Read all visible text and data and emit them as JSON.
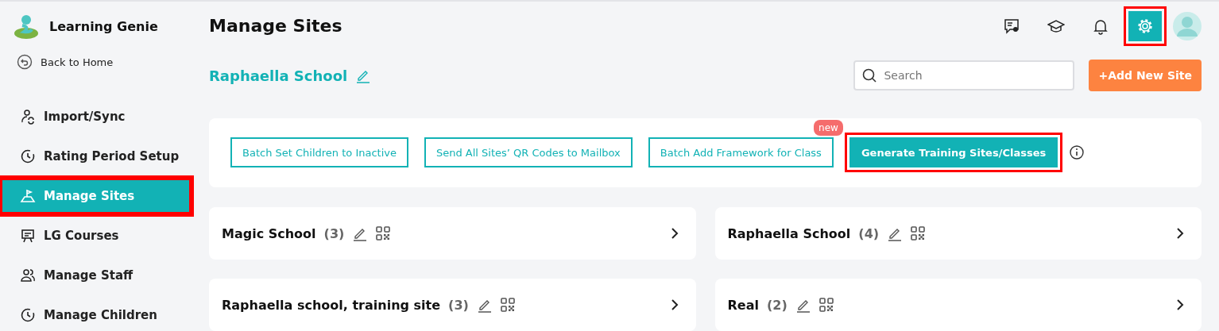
{
  "app": {
    "name": "Learning Genie"
  },
  "sidebar": {
    "back": "Back to Home",
    "items": [
      {
        "label": "Import/Sync",
        "selected": false,
        "highlighted": false
      },
      {
        "label": "Rating Period Setup",
        "selected": false,
        "highlighted": false
      },
      {
        "label": "Manage Sites",
        "selected": true,
        "highlighted": true
      },
      {
        "label": "LG Courses",
        "selected": false,
        "highlighted": false
      },
      {
        "label": "Manage Staff",
        "selected": false,
        "highlighted": false
      },
      {
        "label": "Manage Children",
        "selected": false,
        "highlighted": false
      }
    ]
  },
  "header": {
    "title": "Manage Sites",
    "tools": [
      {
        "selected": false,
        "highlighted": false
      },
      {
        "selected": false,
        "highlighted": false
      },
      {
        "selected": false,
        "highlighted": false
      },
      {
        "selected": true,
        "highlighted": true
      }
    ]
  },
  "school": {
    "name": "Raphaella School"
  },
  "search": {
    "placeholder": "Search"
  },
  "add_button": "+Add New Site",
  "actions": [
    {
      "label": "Batch Set Children to Inactive",
      "kind": "outline",
      "highlighted": false
    },
    {
      "label": "Send All Sites’ QR Codes to Mailbox",
      "kind": "outline",
      "highlighted": false
    },
    {
      "label": "Batch Add Framework for Class",
      "kind": "outline",
      "badge": "new",
      "highlighted": false
    },
    {
      "label": "Generate Training Sites/Classes",
      "kind": "primary",
      "highlighted": true
    }
  ],
  "sites": [
    {
      "name": "Magic School",
      "count": "(3)"
    },
    {
      "name": "Raphaella School",
      "count": "(4)"
    },
    {
      "name": "Raphaella school, training site",
      "count": "(3)"
    },
    {
      "name": "Real",
      "count": "(2)"
    }
  ]
}
